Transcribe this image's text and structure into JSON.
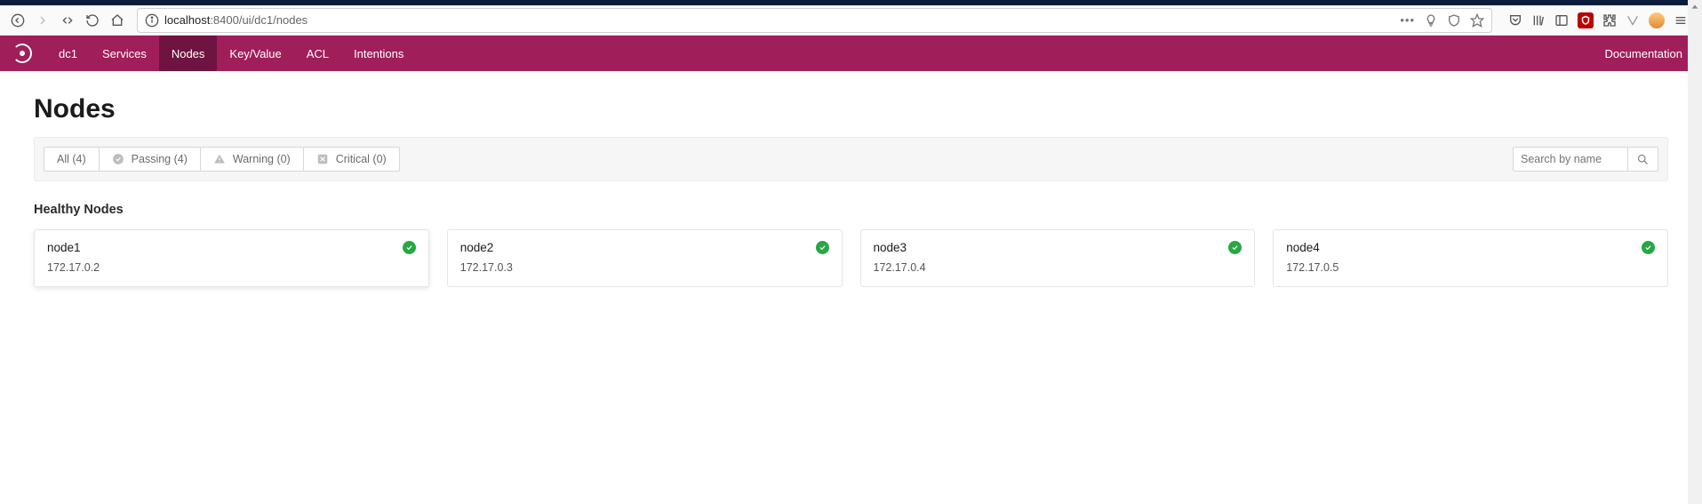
{
  "browser": {
    "url_full": "localhost:8400/ui/dc1/nodes",
    "url_host": "localhost",
    "url_rest": ":8400/ui/dc1/nodes"
  },
  "app": {
    "datacenter": "dc1",
    "nav": {
      "services": "Services",
      "nodes": "Nodes",
      "keyvalue": "Key/Value",
      "acl": "ACL",
      "intentions": "Intentions",
      "documentation": "Documentation"
    }
  },
  "page": {
    "title": "Nodes",
    "filters": {
      "all": "All (4)",
      "passing": "Passing (4)",
      "warning": "Warning (0)",
      "critical": "Critical (0)"
    },
    "search_placeholder": "Search by name",
    "section_title": "Healthy Nodes",
    "nodes": [
      {
        "name": "node1",
        "ip": "172.17.0.2"
      },
      {
        "name": "node2",
        "ip": "172.17.0.3"
      },
      {
        "name": "node3",
        "ip": "172.17.0.4"
      },
      {
        "name": "node4",
        "ip": "172.17.0.5"
      }
    ]
  }
}
